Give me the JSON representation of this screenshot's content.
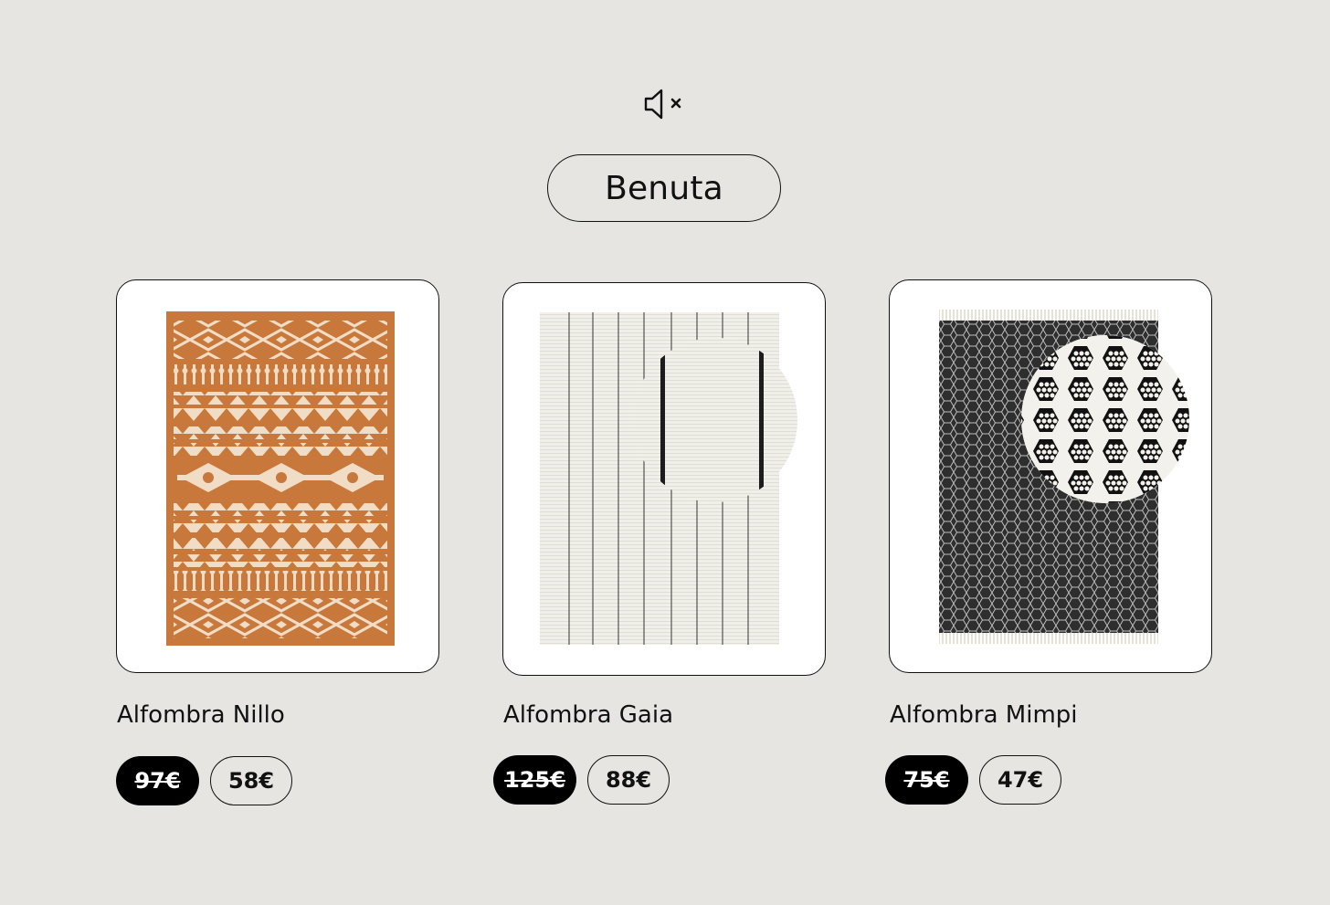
{
  "header": {
    "mute_icon": "speaker-muted-icon",
    "brand_label": "Benuta"
  },
  "products": [
    {
      "title": "Alfombra Nillo",
      "old_price": "97€",
      "new_price": "58€",
      "image": "rug-orange-aztec-pattern",
      "accent": "#c8783a"
    },
    {
      "title": "Alfombra Gaia",
      "old_price": "125€",
      "new_price": "88€",
      "image": "rug-white-pinstripe-with-texture-zoom",
      "accent": "#f1efea"
    },
    {
      "title": "Alfombra Mimpi",
      "old_price": "75€",
      "new_price": "47€",
      "image": "rug-black-white-honeycomb-with-texture-zoom",
      "accent": "#2e2e2e"
    }
  ],
  "colors": {
    "background": "#e6e5e2",
    "old_price_bg": "#000000"
  }
}
